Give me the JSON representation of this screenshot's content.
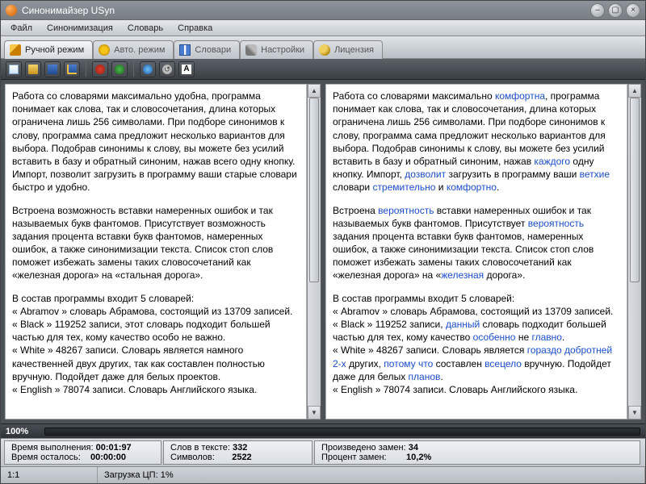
{
  "title": "Синонимайзер USyn",
  "menubar": [
    "Файл",
    "Синонимизация",
    "Словарь",
    "Справка"
  ],
  "tabs": [
    {
      "label": "Ручной режим",
      "icon": "pencil-icon"
    },
    {
      "label": "Авто. режим",
      "icon": "star-icon"
    },
    {
      "label": "Словари",
      "icon": "book-icon"
    },
    {
      "label": "Настройки",
      "icon": "wrench-icon"
    },
    {
      "label": "Лицензия",
      "icon": "key-icon"
    }
  ],
  "toolbar_icons": [
    "new-file-icon",
    "open-file-icon",
    "save-icon",
    "save-as-icon",
    "stop-icon",
    "run-icon",
    "web-icon",
    "swap-icon",
    "font-icon"
  ],
  "left_pane": {
    "p1": "Работа со словарями максимально удобна, программа понимает как слова, так и словосочетания, длина которых ограничена лишь 256 символами. При подборе синонимов к слову, программа сама предложит несколько вариантов для выбора. Подобрав синонимы к слову, вы можете без усилий вставить в базу и обратный синоним, нажав всего одну кнопку. Импорт, позволит загрузить в программу ваши старые словари быстро и удобно.",
    "p2": "Встроена возможность вставки намеренных ошибок и так называемых букв фантомов. Присутствует возможность задания процента вставки букв фантомов, намеренных ошибок, а также синонимизации текста. Список стоп слов поможет избежать замены таких словосочетаний как «железная дорога» на «стальная дорога».",
    "p3_head": "В состав программы входит 5 словарей:",
    "li1": "« Abramov » словарь Абрамова, состоящий из 13709 записей.",
    "li2": "« Black » 119252 записи, этот словарь подходит большей частью для тех, кому качество особо не важно.",
    "li3": "« White » 48267 записи. Словарь является намного качественней двух других, так как составлен полностью вручную.  Подойдет даже для белых проектов.",
    "li4": "« English » 78074 записи. Словарь Английского языка."
  },
  "right_pane": {
    "p1_a": "Работа со словарями максимально ",
    "p1_syn1": "комфортна",
    "p1_b": ", программа понимает как слова, так и словосочетания, длина которых ограничена лишь 256 символами. При подборе синонимов к слову, программа сама предложит несколько вариантов для выбора. Подобрав синонимы к слову, вы можете без усилий вставить в базу и обратный синоним, нажав ",
    "p1_syn2": "каждого",
    "p1_c": " одну кнопку. Импорт, ",
    "p1_syn3": "дозволит",
    "p1_d": " загрузить в программу ваши ",
    "p1_syn4": "ветхие",
    "p1_e": " словари ",
    "p1_syn5": "стремительно",
    "p1_f": " и ",
    "p1_syn6": "комфортно",
    "p1_g": ".",
    "p2_a": "Встроена ",
    "p2_syn1": "вероятность",
    "p2_b": " вставки намеренных ошибок и так называемых букв фантомов. Присутствует ",
    "p2_syn2": "вероятность",
    "p2_c": " задания процента вставки букв фантомов, намеренных ошибок, а также синонимизации текста. Список стоп слов поможет избежать замены таких словосочетаний как «железная дорога» на «",
    "p2_syn3": "железная",
    "p2_d": " дорога».",
    "p3_head": "В состав программы входит 5 словарей:",
    "li1": "« Abramov » словарь Абрамова, состоящий из 13709 записей.",
    "li2_a": "« Black » 119252 записи, ",
    "li2_syn1": "данный",
    "li2_b": " словарь подходит большей частью для тех, кому качество ",
    "li2_syn2": "особенно",
    "li2_c": " не ",
    "li2_syn3": "главно",
    "li2_d": ".",
    "li3_a": "« White » 48267 записи. Словарь является ",
    "li3_syn1": "гораздо добротней 2-х",
    "li3_b": " других, ",
    "li3_syn2": "потому что",
    "li3_c": " составлен ",
    "li3_syn3": "всецело",
    "li3_d": " вручную.  Подойдет даже для белых ",
    "li3_syn4": "планов",
    "li3_e": ".",
    "li4": "« English » 78074 записи. Словарь Английского языка."
  },
  "progress_label": "100%",
  "stats": {
    "exec_time_label": "Время выполнения: ",
    "exec_time_value": "00:01:97",
    "time_left_label": "Время осталось:    ",
    "time_left_value": "00:00:00",
    "words_label": "Слов в тексте: ",
    "words_value": "332",
    "chars_label": "Символов:       ",
    "chars_value": "2522",
    "replaced_label": "Произведено замен: ",
    "replaced_value": "34",
    "percent_label": "Процент замен:        ",
    "percent_value": "10,2%"
  },
  "statusbar": {
    "cursor": "1:1",
    "cpu": "Загрузка ЦП: 1%"
  }
}
